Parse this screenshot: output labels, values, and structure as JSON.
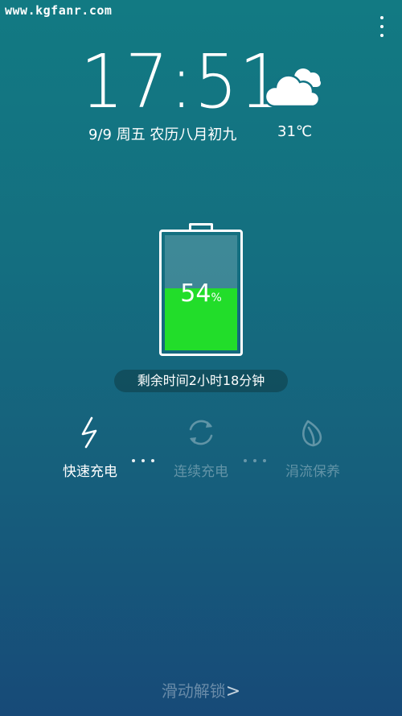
{
  "watermark": "www.kgfanr.com",
  "clock": {
    "time": "17:51",
    "date": "9/9  周五  农历八月初九"
  },
  "weather": {
    "icon": "cloud-icon",
    "temperature": "31℃"
  },
  "battery": {
    "level": 54,
    "level_text": "54",
    "unit": "%",
    "fill_color": "#22dd2a"
  },
  "remaining_time": "剩余时间2小时18分钟",
  "charge_modes": [
    {
      "label": "快速充电",
      "icon": "lightning-icon",
      "active": true
    },
    {
      "label": "连续充电",
      "icon": "cycle-icon",
      "active": false
    },
    {
      "label": "涓流保养",
      "icon": "leaf-icon",
      "active": false
    }
  ],
  "unlock": {
    "label": "滑动解锁",
    "arrow": ">"
  }
}
